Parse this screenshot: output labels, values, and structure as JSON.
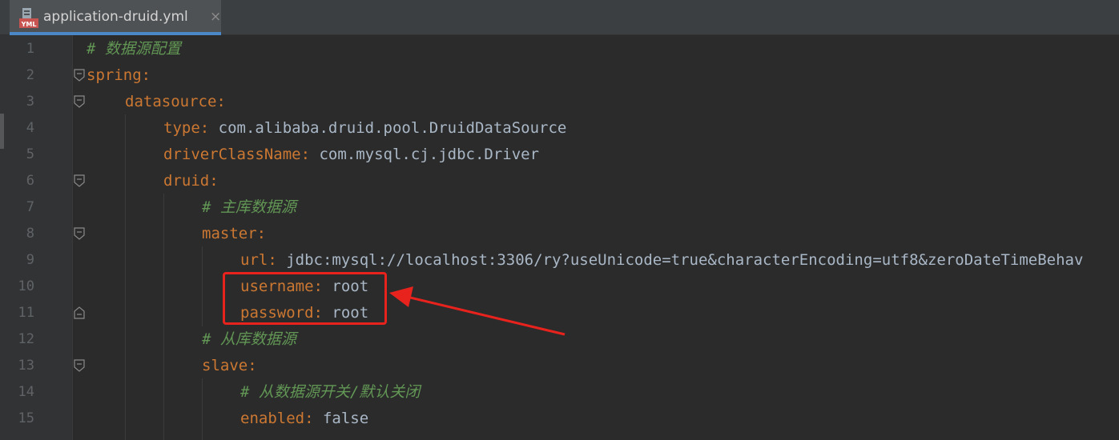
{
  "tab": {
    "title": "application-druid.yml",
    "close_glyph": "×",
    "icon": "yml-file-icon",
    "icon_label": "YML"
  },
  "colors": {
    "background": "#2b2b2b",
    "gutter": "#313335",
    "key": "#cc7832",
    "value": "#a9b7c6",
    "comment": "#629755",
    "annotation": "#e8231e",
    "tab_underline": "#4a88c7"
  },
  "lines": [
    {
      "num": "1",
      "comment": "# 数据源配置"
    },
    {
      "num": "2",
      "key": "spring",
      "sep": ":"
    },
    {
      "num": "3",
      "key": "datasource",
      "sep": ":"
    },
    {
      "num": "4",
      "key": "type",
      "sep": ":",
      "value": " com.alibaba.druid.pool.DruidDataSource"
    },
    {
      "num": "5",
      "key": "driverClassName",
      "sep": ":",
      "value": " com.mysql.cj.jdbc.Driver"
    },
    {
      "num": "6",
      "key": "druid",
      "sep": ":"
    },
    {
      "num": "7",
      "comment": "# 主库数据源"
    },
    {
      "num": "8",
      "key": "master",
      "sep": ":"
    },
    {
      "num": "9",
      "key": "url",
      "sep": ":",
      "value": " jdbc:mysql://localhost:3306/ry?useUnicode=true&characterEncoding=utf8&zeroDateTimeBehav"
    },
    {
      "num": "10",
      "key": "username",
      "sep": ":",
      "value": " root"
    },
    {
      "num": "11",
      "key": "password",
      "sep": ":",
      "value": " root"
    },
    {
      "num": "12",
      "comment": "# 从库数据源"
    },
    {
      "num": "13",
      "key": "slave",
      "sep": ":"
    },
    {
      "num": "14",
      "comment": "# 从数据源开关/默认关闭"
    },
    {
      "num": "15",
      "key": "enabled",
      "sep": ":",
      "value": " false"
    }
  ]
}
